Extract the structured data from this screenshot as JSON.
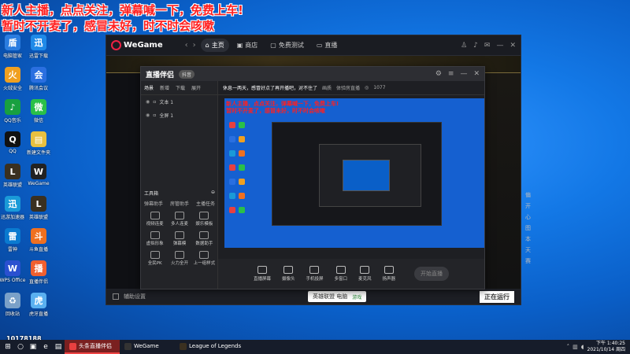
{
  "overlay": {
    "line1": "新人主播，点点关注，弹幕喊一下，免费上车!",
    "line2": "暂时不开麦了，感冒未好，时不时会咳嗽"
  },
  "desktop_icons": [
    {
      "label": "电脑管家",
      "icon": "shield-icon",
      "color": "#2b7de0",
      "glyph": "盾"
    },
    {
      "label": "迅雷下载",
      "icon": "thunder-icon",
      "color": "#1f8ae8",
      "glyph": "迅"
    },
    {
      "label": "火绒安全",
      "icon": "fire-icon",
      "color": "#f0a020",
      "glyph": "火"
    },
    {
      "label": "腾讯会议",
      "icon": "meeting-icon",
      "color": "#2a6fe0",
      "glyph": "会"
    },
    {
      "label": "QQ音乐",
      "icon": "music-icon",
      "color": "#18a040",
      "glyph": "♪"
    },
    {
      "label": "微信",
      "icon": "wechat-icon",
      "color": "#2ac048",
      "glyph": "微"
    },
    {
      "label": "QQ",
      "icon": "qq-icon",
      "color": "#111",
      "glyph": "Q"
    },
    {
      "label": "新建文件夹",
      "icon": "folder-icon",
      "color": "#e8c040",
      "glyph": "▤"
    },
    {
      "label": "英雄联盟",
      "icon": "lol-icon",
      "color": "#3a3020",
      "glyph": "L"
    },
    {
      "label": "WeGame",
      "icon": "wegame-icon",
      "color": "#222",
      "glyph": "W"
    },
    {
      "label": "迅游加速器",
      "icon": "accelerator-icon",
      "color": "#1a9ad8",
      "glyph": "迅"
    },
    {
      "label": "英雄联盟",
      "icon": "lol-icon",
      "color": "#3a3020",
      "glyph": "L"
    },
    {
      "label": "雷神",
      "icon": "leishen-icon",
      "color": "#0a7ad0",
      "glyph": "雷"
    },
    {
      "label": "斗鱼直播",
      "icon": "douyu-icon",
      "color": "#f07020",
      "glyph": "斗"
    },
    {
      "label": "WPS Office",
      "icon": "wps-icon",
      "color": "#2a50d0",
      "glyph": "W"
    },
    {
      "label": "直播伴侣",
      "icon": "live-icon",
      "color": "#f06030",
      "glyph": "播"
    },
    {
      "label": "回收站",
      "icon": "recycle-bin-icon",
      "color": "#7aa0c8",
      "glyph": "♻"
    },
    {
      "label": "虎牙直播",
      "icon": "huya-icon",
      "color": "#5ab0f0",
      "glyph": "虎"
    }
  ],
  "qq_id": "10178188",
  "wegame": {
    "logo": "WeGame",
    "tabs": [
      {
        "label": "主页",
        "icon": "home-icon",
        "active": true
      },
      {
        "label": "商店",
        "icon": "store-icon",
        "active": false
      },
      {
        "label": "免费测试",
        "icon": "gamepad-icon",
        "active": false
      },
      {
        "label": "直播",
        "icon": "tv-icon",
        "active": false
      }
    ],
    "right_text": [
      "偏开心",
      "图",
      "本天",
      "赛"
    ],
    "status_text": "辅助设置",
    "download_text": "英雄联盟 电脑",
    "download_tag": "游戏",
    "play_button": "正在运行"
  },
  "obs": {
    "title": "直播伴侣",
    "title_badge": "抖音",
    "left_tabs": [
      "场景",
      "新增",
      "下载",
      "展开"
    ],
    "scenes": [
      {
        "label": "文本 1"
      },
      {
        "label": "全屏 1"
      }
    ],
    "tools_label": "工具箱",
    "tool_tabs": [
      "弹幕助手",
      "房管助手",
      "主播任务"
    ],
    "tools": [
      {
        "label": "视频连麦",
        "icon": "video-icon"
      },
      {
        "label": "多人连麦",
        "icon": "multi-mic-icon"
      },
      {
        "label": "娱乐模板",
        "icon": "template-icon"
      },
      {
        "label": "虚拟形象",
        "icon": "avatar-icon"
      },
      {
        "label": "弹幕模",
        "icon": "danmaku-icon"
      },
      {
        "label": "数据助手",
        "icon": "data-icon"
      },
      {
        "label": "全民PK",
        "icon": "pk-icon"
      },
      {
        "label": "火力全开",
        "icon": "fire-power-icon"
      },
      {
        "label": "上一组样式",
        "icon": "style-icon"
      }
    ],
    "top_info": {
      "title": "休息一两天，感冒好点了再开播吧，对不住了",
      "tag": "画质",
      "sub": "体验房直播",
      "viewers": "1077"
    },
    "bottom_buttons": [
      {
        "label": "直播屏幕",
        "icon": "screen-icon"
      },
      {
        "label": "摄像头",
        "icon": "camera-icon"
      },
      {
        "label": "手机投屏",
        "icon": "phone-cast-icon"
      },
      {
        "label": "多窗口",
        "icon": "multi-window-icon"
      },
      {
        "label": "麦克风",
        "icon": "mic-icon"
      },
      {
        "label": "扬声器",
        "icon": "speaker-icon"
      }
    ],
    "start_live": "开始直播"
  },
  "taskbar": {
    "tasks": [
      {
        "label": "头条直播伴侣",
        "active": true,
        "color": "#e84040"
      },
      {
        "label": "WeGame",
        "active": false,
        "color": "#333"
      },
      {
        "label": "League of Legends",
        "active": false,
        "color": "#3a3020"
      }
    ],
    "time": "下午 1:40:25",
    "date": "2021/10/14 周四"
  }
}
